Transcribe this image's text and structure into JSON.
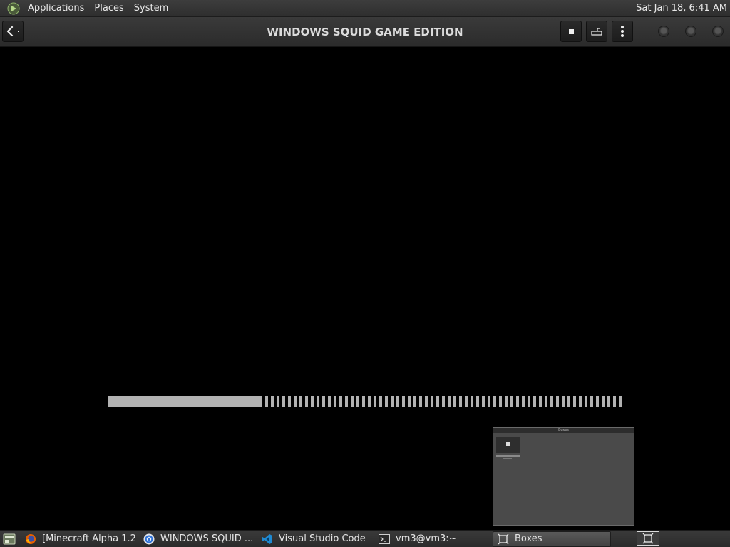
{
  "top_panel": {
    "logo_icon": "mate-logo-icon",
    "menus": [
      "Applications",
      "Places",
      "System"
    ],
    "clock": "Sat Jan 18,  6:41 AM"
  },
  "header": {
    "title": "WINDOWS SQUID GAME EDITION",
    "back_icon": "back-arrow-icon",
    "buttons": [
      "stop-icon",
      "keyboard-icon",
      "menu-icon"
    ],
    "window_controls": [
      "minimize",
      "maximize",
      "close"
    ]
  },
  "vm": {
    "progress": 0.3,
    "preview_title": "Boxes"
  },
  "taskbar": {
    "show_desktop_icon": "show-desktop-icon",
    "tasks": [
      {
        "label": "[Minecraft Alpha 1.2...",
        "icon": "firefox-icon",
        "active": false
      },
      {
        "label": "WINDOWS SQUID ...",
        "icon": "chrome-icon",
        "active": false
      },
      {
        "label": "Visual Studio Code",
        "icon": "vscode-icon",
        "active": false
      },
      {
        "label": "vm3@vm3:~",
        "icon": "terminal-icon",
        "active": false
      },
      {
        "label": "Boxes",
        "icon": "boxes-icon",
        "active": true
      }
    ],
    "workspace_icon": "boxes-icon"
  },
  "colors": {
    "panel_bg": "#333333",
    "display_bg": "#000000",
    "progress": "#b2b2b2",
    "text": "#e6e6e6"
  }
}
